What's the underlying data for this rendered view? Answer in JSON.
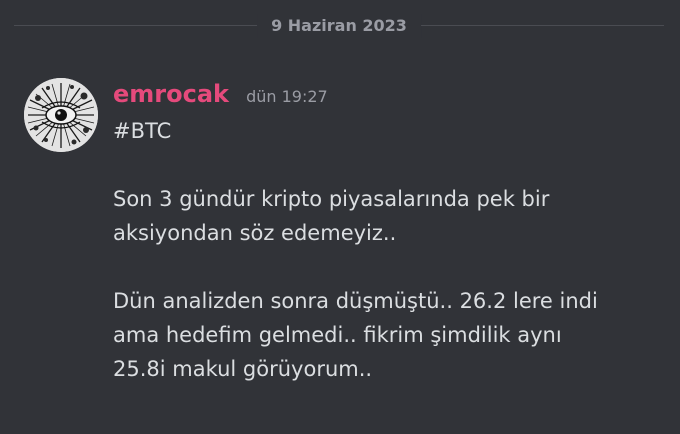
{
  "divider": {
    "date": "9 Haziran 2023"
  },
  "message": {
    "author": "emrocak",
    "timestamp": "dün 19:27",
    "author_color": "#e54a7c",
    "avatar_icon": "avatar-image",
    "paragraphs": [
      "#BTC",
      "Son 3 gündür kripto piyasalarında pek bir\naksiyondan söz edemeyiz..",
      "Dün analizden sonra düşmüştü.. 26.2 lere indi\nama hedefim gelmedi.. fikrim şimdilik aynı\n25.8i makul görüyorum.."
    ]
  },
  "colors": {
    "background": "#313338",
    "text": "#dbdee1",
    "muted": "#9a9ca4"
  }
}
